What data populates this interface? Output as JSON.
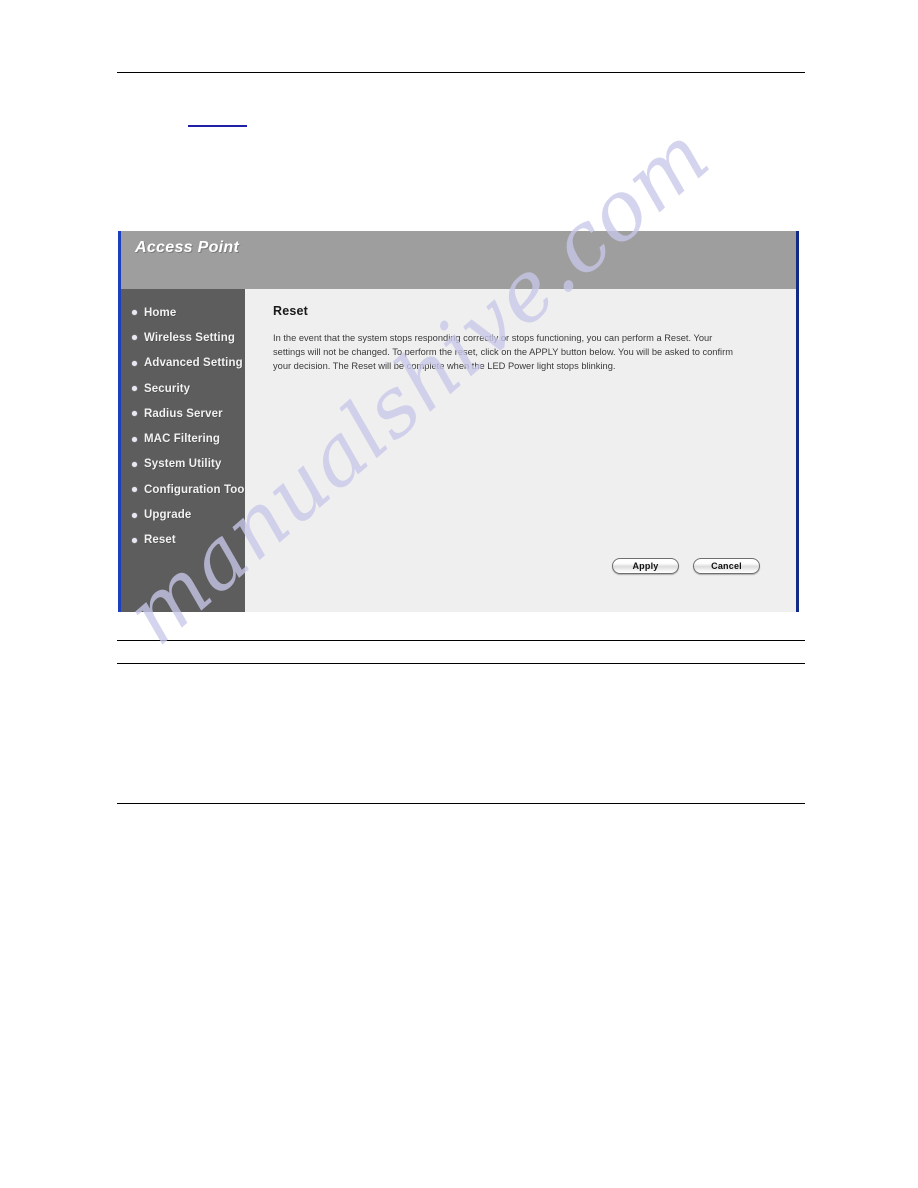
{
  "page": {
    "blue_underline_present": true
  },
  "access_point": {
    "header_title": "Access Point",
    "sidebar": {
      "items": [
        {
          "label": "Home"
        },
        {
          "label": "Wireless Setting"
        },
        {
          "label": "Advanced Setting"
        },
        {
          "label": "Security"
        },
        {
          "label": "Radius Server"
        },
        {
          "label": "MAC Filtering"
        },
        {
          "label": "System Utility"
        },
        {
          "label": "Configuration Tool"
        },
        {
          "label": "Upgrade"
        },
        {
          "label": "Reset"
        }
      ]
    },
    "content": {
      "title": "Reset",
      "paragraph": "In the event that the system stops responding correctly or stops functioning, you can perform a Reset. Your settings will not be changed. To perform the reset, click on the APPLY button below. You will be asked to confirm your decision. The Reset will be complete when the LED Power light stops blinking."
    },
    "buttons": {
      "apply_label": "Apply",
      "cancel_label": "Cancel"
    },
    "colors": {
      "header_bg": "#9e9e9e",
      "sidebar_bg": "#5d5d5d",
      "content_bg": "#efefef",
      "border_left": "#1c3fbe",
      "border_right": "#102a86",
      "underline": "#1f1fa8"
    }
  },
  "watermark": {
    "text": "manualshive.com",
    "color": "#c8c8ea"
  }
}
